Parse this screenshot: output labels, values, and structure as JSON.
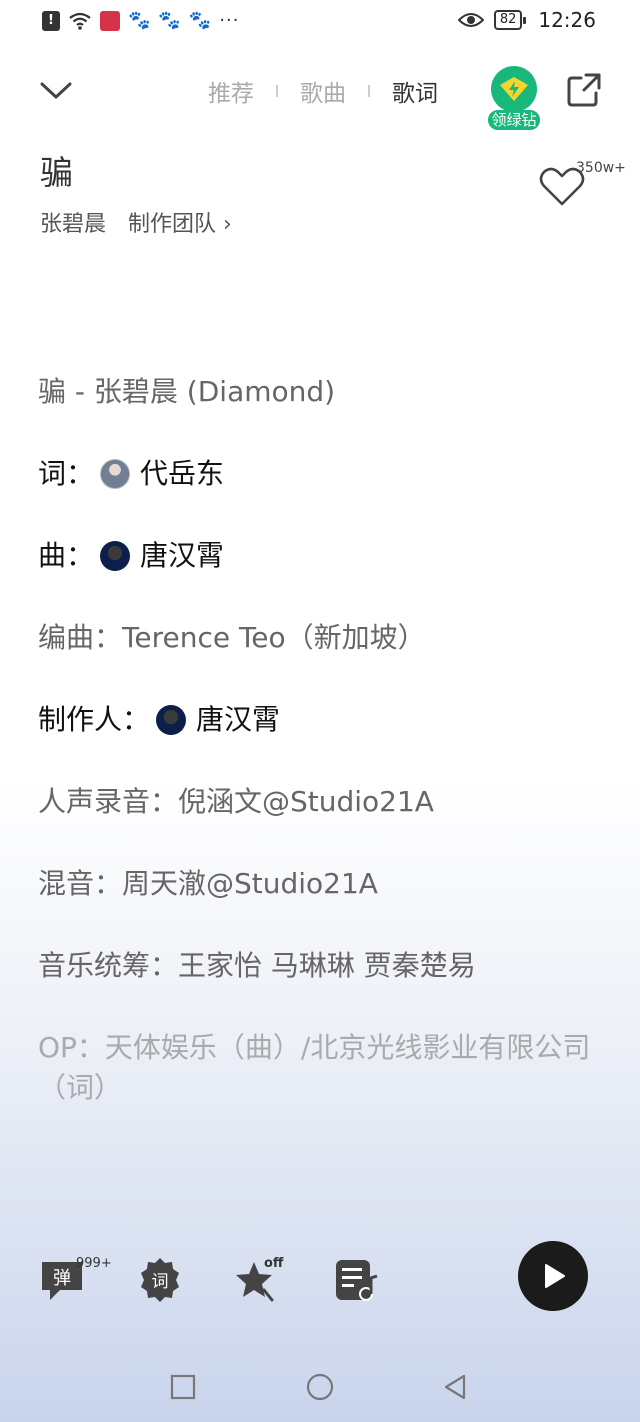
{
  "status_bar": {
    "alert_glyph": "!",
    "more_dots": "···",
    "battery": "82",
    "time": "12:26"
  },
  "nav": {
    "tabs": [
      {
        "label": "推荐",
        "active": false
      },
      {
        "label": "歌曲",
        "active": false
      },
      {
        "label": "歌词",
        "active": true
      }
    ],
    "vip_label": "领绿钻"
  },
  "song": {
    "title": "骗",
    "artist": "张碧晨",
    "team_link": "制作团队 ›",
    "like_count": "350w+"
  },
  "lyrics": [
    "骗 - 张碧晨 (Diamond)",
    "词：",
    "代岳东",
    "曲：",
    "唐汉霄",
    "编曲：Terence Teo（新加坡）",
    "制作人：",
    "唐汉霄",
    "人声录音：倪涵文@Studio21A",
    "混音：周天澈@Studio21A",
    "音乐统筹：王家怡 马琳琳 贾秦楚易",
    "OP：天体娱乐（曲）/北京光线影业有限公司（词）"
  ],
  "bottom_bar": {
    "danmaku_label": "弹",
    "danmaku_count": "999+",
    "lyric_label": "词",
    "star_off_label": "off"
  }
}
